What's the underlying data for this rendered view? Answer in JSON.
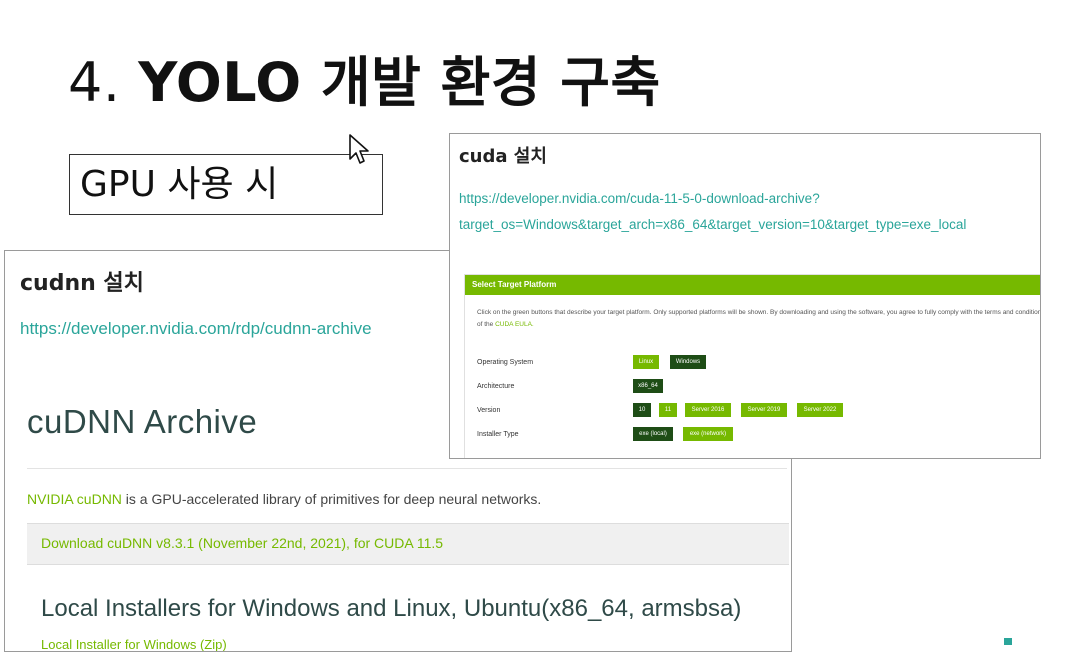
{
  "slide": {
    "title_num": "4.",
    "title_rest": "YOLO 개발 환경 구축",
    "gpu_label": "GPU 사용 시"
  },
  "cudnn": {
    "heading": "cudnn 설치",
    "link": "https://developer.nvidia.com/rdp/cudnn-archive",
    "archive_title": "cuDNN Archive",
    "desc_brand": "NVIDIA cuDNN",
    "desc_rest": " is a GPU-accelerated library of primitives for deep neural networks.",
    "download_text": "Download cuDNN v8.3.1 (November 22nd, 2021), for CUDA 11.5",
    "installers_heading": "Local Installers for Windows and Linux, Ubuntu(x86_64, armsbsa)",
    "installers_link": "Local Installer for Windows (Zip)"
  },
  "cuda": {
    "heading": "cuda 설치",
    "link_line1": "https://developer.nvidia.com/cuda-11-5-0-download-archive?",
    "link_line2": "target_os=Windows&target_arch=x86_64&target_version=10&target_type=exe_local",
    "platform": {
      "header": "Select Target Platform",
      "intro": "Click on the green buttons that describe your target platform. Only supported platforms will be shown. By downloading and using the software, you agree to fully comply with the terms and conditions of the",
      "eula": "CUDA EULA.",
      "rows": {
        "os": {
          "label": "Operating System",
          "options": [
            "Linux",
            "Windows"
          ]
        },
        "arch": {
          "label": "Architecture",
          "options": [
            "x86_64"
          ]
        },
        "version": {
          "label": "Version",
          "options": [
            "10",
            "11",
            "Server 2016",
            "Server 2019",
            "Server 2022"
          ]
        },
        "installer": {
          "label": "Installer Type",
          "options": [
            "exe (local)",
            "exe (network)"
          ]
        }
      }
    }
  },
  "colors": {
    "nvidia_green": "#76b900",
    "link_teal": "#2aa59a",
    "selected_dark": "#1e4d16"
  }
}
